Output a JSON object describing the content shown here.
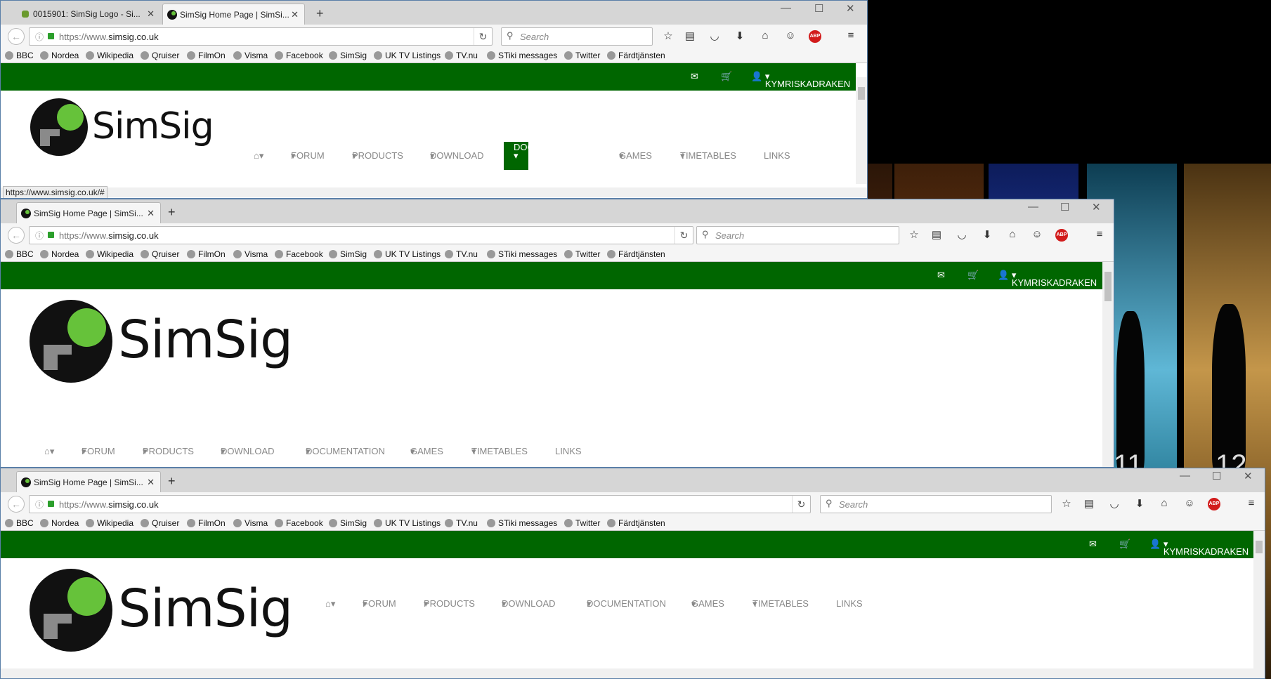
{
  "window1": {
    "tabs": [
      {
        "title": "0015901: SimSig Logo - Si..."
      },
      {
        "title": "SimSig Home Page | SimSi..."
      }
    ],
    "url_prefix": "https://www.",
    "url_domain": "simsig.co.uk",
    "search_placeholder": "Search",
    "status_url": "https://www.simsig.co.uk/#"
  },
  "window2": {
    "tabs": [
      {
        "title": "SimSig Home Page | SimSi..."
      }
    ],
    "url_prefix": "https://www.",
    "url_domain": "simsig.co.uk",
    "search_placeholder": "Search"
  },
  "window3": {
    "tabs": [
      {
        "title": "SimSig Home Page | SimSi..."
      }
    ],
    "url_prefix": "https://www.",
    "url_domain": "simsig.co.uk",
    "search_placeholder": "Search"
  },
  "bookmarks": [
    "BBC",
    "Nordea",
    "Wikipedia",
    "Qruiser",
    "FilmOn",
    "Visma",
    "Facebook",
    "SimSig",
    "UK TV Listings",
    "TV.nu",
    "STiki messages",
    "Twitter",
    "Färdtjänsten"
  ],
  "site": {
    "username": "KYMRISKADRAKEN",
    "logo_text": "SimSig",
    "nav": [
      "FORUM",
      "PRODUCTS",
      "DOWNLOAD",
      "DOCUMENTATION",
      "GAMES",
      "TIMETABLES",
      "LINKS"
    ],
    "active_nav": "DOCUMENTATION",
    "brand_green": "#006600",
    "logo_dot_green": "#66c23a"
  },
  "wallpaper": {
    "panel_numbers": [
      "11",
      "12"
    ]
  }
}
